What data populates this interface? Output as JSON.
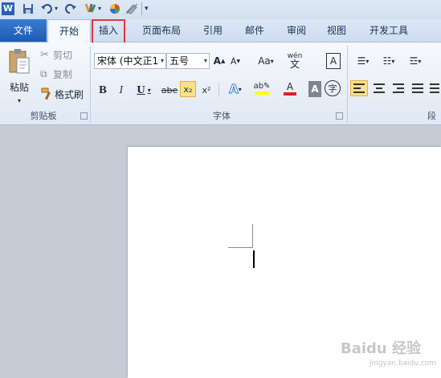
{
  "tabs": {
    "file": "文件",
    "home": "开始",
    "insert": "插入",
    "page_layout": "页面布局",
    "references": "引用",
    "mailings": "邮件",
    "review": "审阅",
    "view": "视图",
    "developer": "开发工具"
  },
  "clipboard": {
    "paste": "粘贴",
    "cut": "剪切",
    "copy": "复制",
    "format_painter": "格式刷",
    "group_label": "剪贴板"
  },
  "font": {
    "font_name": "宋体 (中文正1",
    "font_size": "五号",
    "group_label": "字体",
    "bold": "B",
    "italic": "I",
    "underline": "U",
    "strike": "abe",
    "subscript": "x₂",
    "superscript": "x²",
    "change_case": "Aa",
    "grow": "A",
    "shrink": "A",
    "pinyin": "wén",
    "pinyin_char": "文",
    "border_char": "A",
    "char_shading": "A",
    "enclose": "字"
  },
  "paragraph": {
    "group_label_partial": "段"
  },
  "watermark": {
    "brand": "Baidu 经验",
    "url": "jingyan.baidu.com"
  },
  "colors": {
    "file_tab": "#2a6bc4",
    "highlight_box": "#e0393d",
    "font_color": "#e02020",
    "highlight_color": "#ffff00"
  }
}
